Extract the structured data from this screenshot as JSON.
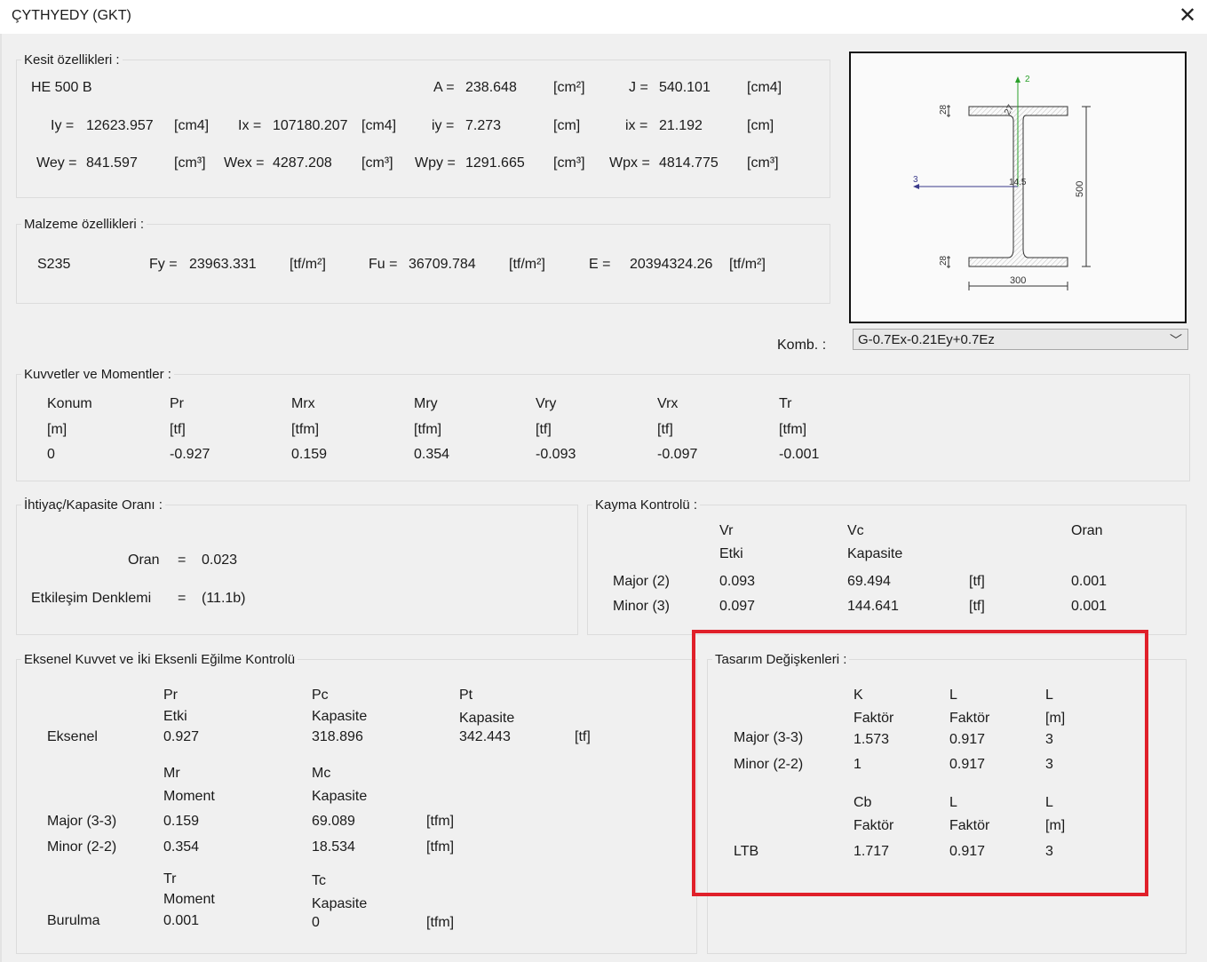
{
  "window": {
    "title": "ÇYTHYEDY (GKT)",
    "close": "✕"
  },
  "kesit": {
    "legend": "Kesit özellikleri :",
    "name": "HE 500 B",
    "A_label": "A =",
    "A": "238.648",
    "A_unit": "[cm²]",
    "J_label": "J =",
    "J": "540.101",
    "J_unit": "[cm4]",
    "Iy_label": "Iy =",
    "Iy": "12623.957",
    "Iy_unit": "[cm4]",
    "Ix_label": "Ix =",
    "Ix": "107180.207",
    "Ix_unit": "[cm4]",
    "iy_label": "iy =",
    "iy": "7.273",
    "iy_unit": "[cm]",
    "ix_label": "ix =",
    "ix": "21.192",
    "ix_unit": "[cm]",
    "Wey_label": "Wey =",
    "Wey": "841.597",
    "Wey_unit": "[cm³]",
    "Wex_label": "Wex =",
    "Wex": "4287.208",
    "Wex_unit": "[cm³]",
    "Wpy_label": "Wpy =",
    "Wpy": "1291.665",
    "Wpy_unit": "[cm³]",
    "Wpx_label": "Wpx =",
    "Wpx": "4814.775",
    "Wpx_unit": "[cm³]"
  },
  "malzeme": {
    "legend": "Malzeme özellikleri :",
    "name": "S235",
    "Fy_label": "Fy =",
    "Fy": "23963.331",
    "Fy_unit": "[tf/m²]",
    "Fu_label": "Fu =",
    "Fu": "36709.784",
    "Fu_unit": "[tf/m²]",
    "E_label": "E =",
    "E": "20394324.26",
    "E_unit": "[tf/m²]"
  },
  "drawing": {
    "axis2": "2",
    "axis3": "3",
    "tf_top": "28",
    "tf_bot": "28",
    "r": "27",
    "tw": "14.5",
    "height": "500",
    "width": "300"
  },
  "komb": {
    "label": "Komb. :",
    "value": "G-0.7Ex-0.21Ey+0.7Ez",
    "arrow": "﹀"
  },
  "kuvvet": {
    "legend": "Kuvvetler ve Momentler :",
    "headers": [
      "Konum",
      "Pr",
      "Mrx",
      "Mry",
      "Vry",
      "Vrx",
      "Tr"
    ],
    "units": [
      "[m]",
      "[tf]",
      "[tfm]",
      "[tfm]",
      "[tf]",
      "[tf]",
      "[tfm]"
    ],
    "values": [
      "0",
      "-0.927",
      "0.159",
      "0.354",
      "-0.093",
      "-0.097",
      "-0.001"
    ]
  },
  "ihtiyac": {
    "legend": "İhtiyaç/Kapasite Oranı :",
    "oran_label": "Oran",
    "eq1": "=",
    "oran": "0.023",
    "etk_label": "Etkileşim Denklemi",
    "eq2": "=",
    "etk": "(11.1b)"
  },
  "kayma": {
    "legend": "Kayma Kontrolü :",
    "vr": "Vr",
    "vr_sub": "Etki",
    "vc": "Vc",
    "vc_sub": "Kapasite",
    "oran": "Oran",
    "major_label": "Major (2)",
    "major_vr": "0.093",
    "major_vc": "69.494",
    "major_unit": "[tf]",
    "major_oran": "0.001",
    "minor_label": "Minor (3)",
    "minor_vr": "0.097",
    "minor_vc": "144.641",
    "minor_unit": "[tf]",
    "minor_oran": "0.001"
  },
  "eksenel": {
    "legend": "Eksenel Kuvvet ve İki Eksenli Eğilme Kontrolü",
    "pr": "Pr",
    "pr_sub": "Etki",
    "pc": "Pc",
    "pc_sub": "Kapasite",
    "pt": "Pt",
    "pt_sub": "Kapasite",
    "eks_label": "Eksenel",
    "eks_pr": "0.927",
    "eks_pc": "318.896",
    "eks_pt": "342.443",
    "eks_unit": "[tf]",
    "mr": "Mr",
    "mr_sub": "Moment",
    "mc": "Mc",
    "mc_sub": "Kapasite",
    "major_label": "Major (3-3)",
    "major_mr": "0.159",
    "major_mc": "69.089",
    "major_unit": "[tfm]",
    "minor_label": "Minor (2-2)",
    "minor_mr": "0.354",
    "minor_mc": "18.534",
    "minor_unit": "[tfm]",
    "tr": "Tr",
    "tr_sub": "Moment",
    "tc": "Tc",
    "tc_sub": "Kapasite",
    "bur_label": "Burulma",
    "bur_tr": "0.001",
    "bur_tc": "0",
    "bur_unit": "[tfm]"
  },
  "tasarim": {
    "legend": "Tasarım Değişkenleri :",
    "k": "K",
    "k_sub": "Faktör",
    "l1": "L",
    "l1_sub": "Faktör",
    "l2": "L",
    "l2_sub": "[m]",
    "major_label": "Major (3-3)",
    "major_k": "1.573",
    "major_l1": "0.917",
    "major_l2": "3",
    "minor_label": "Minor (2-2)",
    "minor_k": "1",
    "minor_l1": "0.917",
    "minor_l2": "3",
    "cb": "Cb",
    "cb_sub": "Faktör",
    "l3": "L",
    "l3_sub": "Faktör",
    "l4": "L",
    "l4_sub": "[m]",
    "ltb_label": "LTB",
    "ltb_cb": "1.717",
    "ltb_l1": "0.917",
    "ltb_l2": "3"
  }
}
